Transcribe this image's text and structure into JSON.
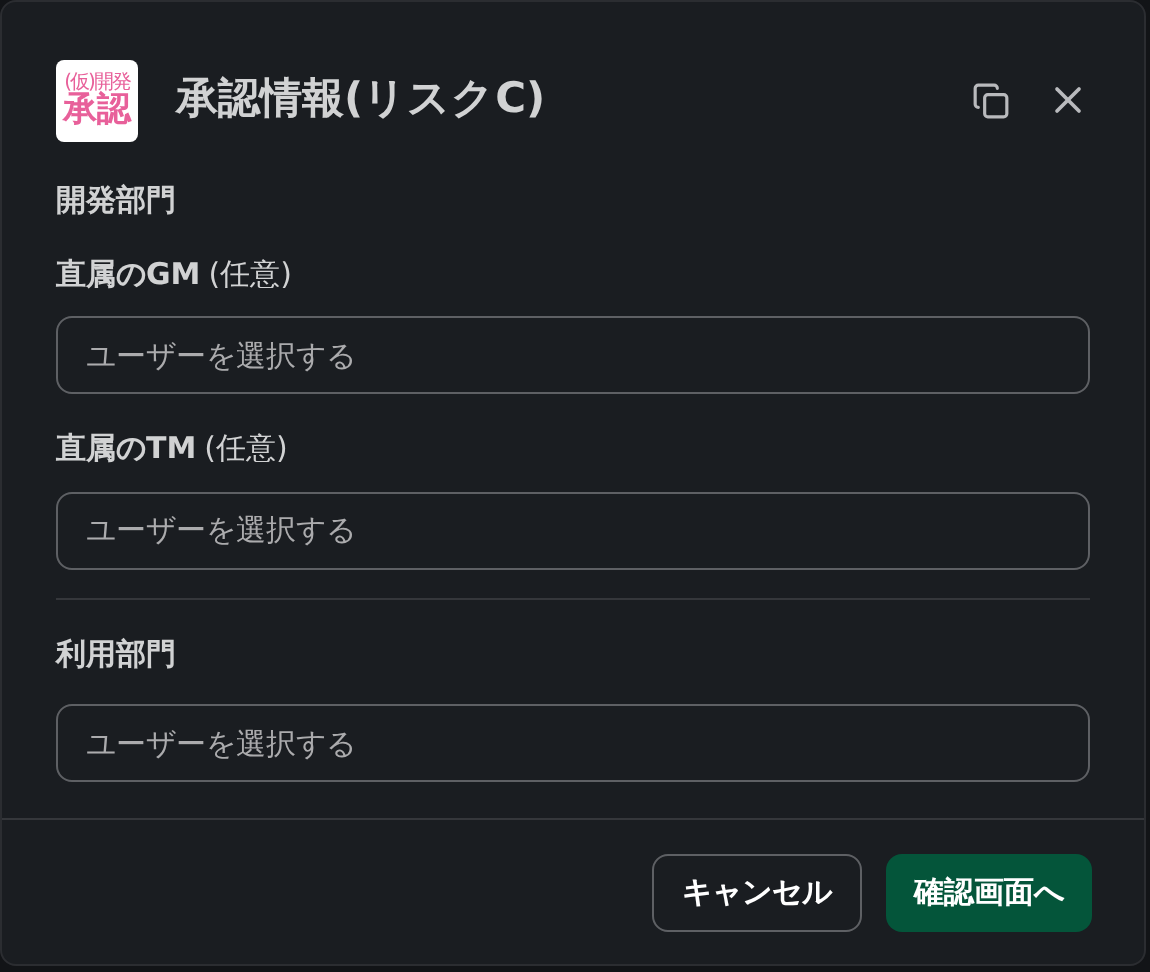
{
  "app_icon": {
    "line_1": "(仮)開発",
    "line_2": "承認"
  },
  "title": "承認情報(リスクC)",
  "sections": [
    {
      "heading": "開発部門",
      "fields": [
        {
          "label": "直属のGM",
          "optional": "(任意)",
          "placeholder": "ユーザーを選択する"
        },
        {
          "label": "直属のTM",
          "optional": "(任意)",
          "placeholder": "ユーザーを選択する"
        }
      ]
    },
    {
      "heading": "利用部門",
      "fields": [
        {
          "placeholder": "ユーザーを選択する"
        }
      ]
    }
  ],
  "buttons": [
    {
      "label": "キャンセル",
      "kind": "secondary"
    },
    {
      "label": "確認画面へ",
      "kind": "primary"
    }
  ]
}
